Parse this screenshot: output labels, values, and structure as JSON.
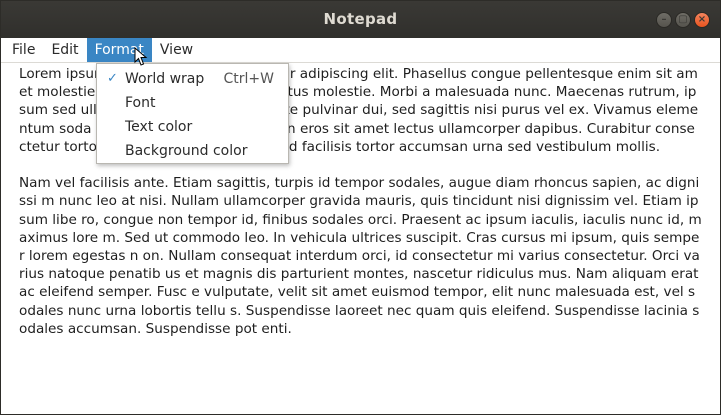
{
  "window": {
    "title": "Notepad",
    "controls": {
      "minimize": "–",
      "maximize": "▢",
      "close": "×"
    }
  },
  "menubar": {
    "items": [
      "File",
      "Edit",
      "Format",
      "View"
    ],
    "active": "Format"
  },
  "format_menu": {
    "items": [
      {
        "label": "World wrap",
        "shortcut": "Ctrl+W",
        "checked": true
      },
      {
        "label": "Font",
        "shortcut": "",
        "checked": false
      },
      {
        "label": "Text color",
        "shortcut": "",
        "checked": false
      },
      {
        "label": "Background color",
        "shortcut": "",
        "checked": false
      }
    ],
    "check_glyph": "✓"
  },
  "editor": {
    "content": "Lorem ipsum dolor sit amet, consectetur adipiscing elit. Phasellus congue pellentesque enim sit amet molestie. Integer eget turpis quis lectus molestie. Morbi a malesuada nunc. Maecenas rutrum, ipsum sed ullamcorper dignissim, nisi ante pulvinar dui, sed sagittis nisi purus vel ex. Vivamus elementum soda les eros nec ultrices. Sed non eros sit amet lectus ullamcorper dapibus. Curabitur consectetur tortor vel purus euismod mollis, id facilisis tortor accumsan urna sed vestibulum mollis.\n\nNam vel facilisis ante. Etiam sagittis, turpis id tempor sodales, augue diam rhoncus sapien, ac dignissi m nunc leo at nisi. Nullam ullamcorper gravida mauris, quis tincidunt nisi dignissim vel. Etiam ipsum libe ro, congue non tempor id, finibus sodales orci. Praesent ac ipsum iaculis, iaculis nunc id, maximus lore m. Sed ut commodo leo. In vehicula ultrices suscipit. Cras cursus mi ipsum, quis semper lorem egestas n on. Nullam consequat interdum orci, id consectetur mi varius consectetur. Orci varius natoque penatib us et magnis dis parturient montes, nascetur ridiculus mus. Nam aliquam erat ac eleifend semper. Fusc e vulputate, velit sit amet euismod tempor, elit nunc malesuada est, vel sodales nunc urna lobortis tellu s. Suspendisse laoreet nec quam quis eleifend. Suspendisse lacinia sodales accumsan. Suspendisse pot enti."
  },
  "colors": {
    "titlebar": "#3a3935",
    "title_text": "#dfdbd2",
    "close_button": "#e9541f",
    "menu_highlight": "#3a86c4",
    "check": "#3a86c4"
  }
}
